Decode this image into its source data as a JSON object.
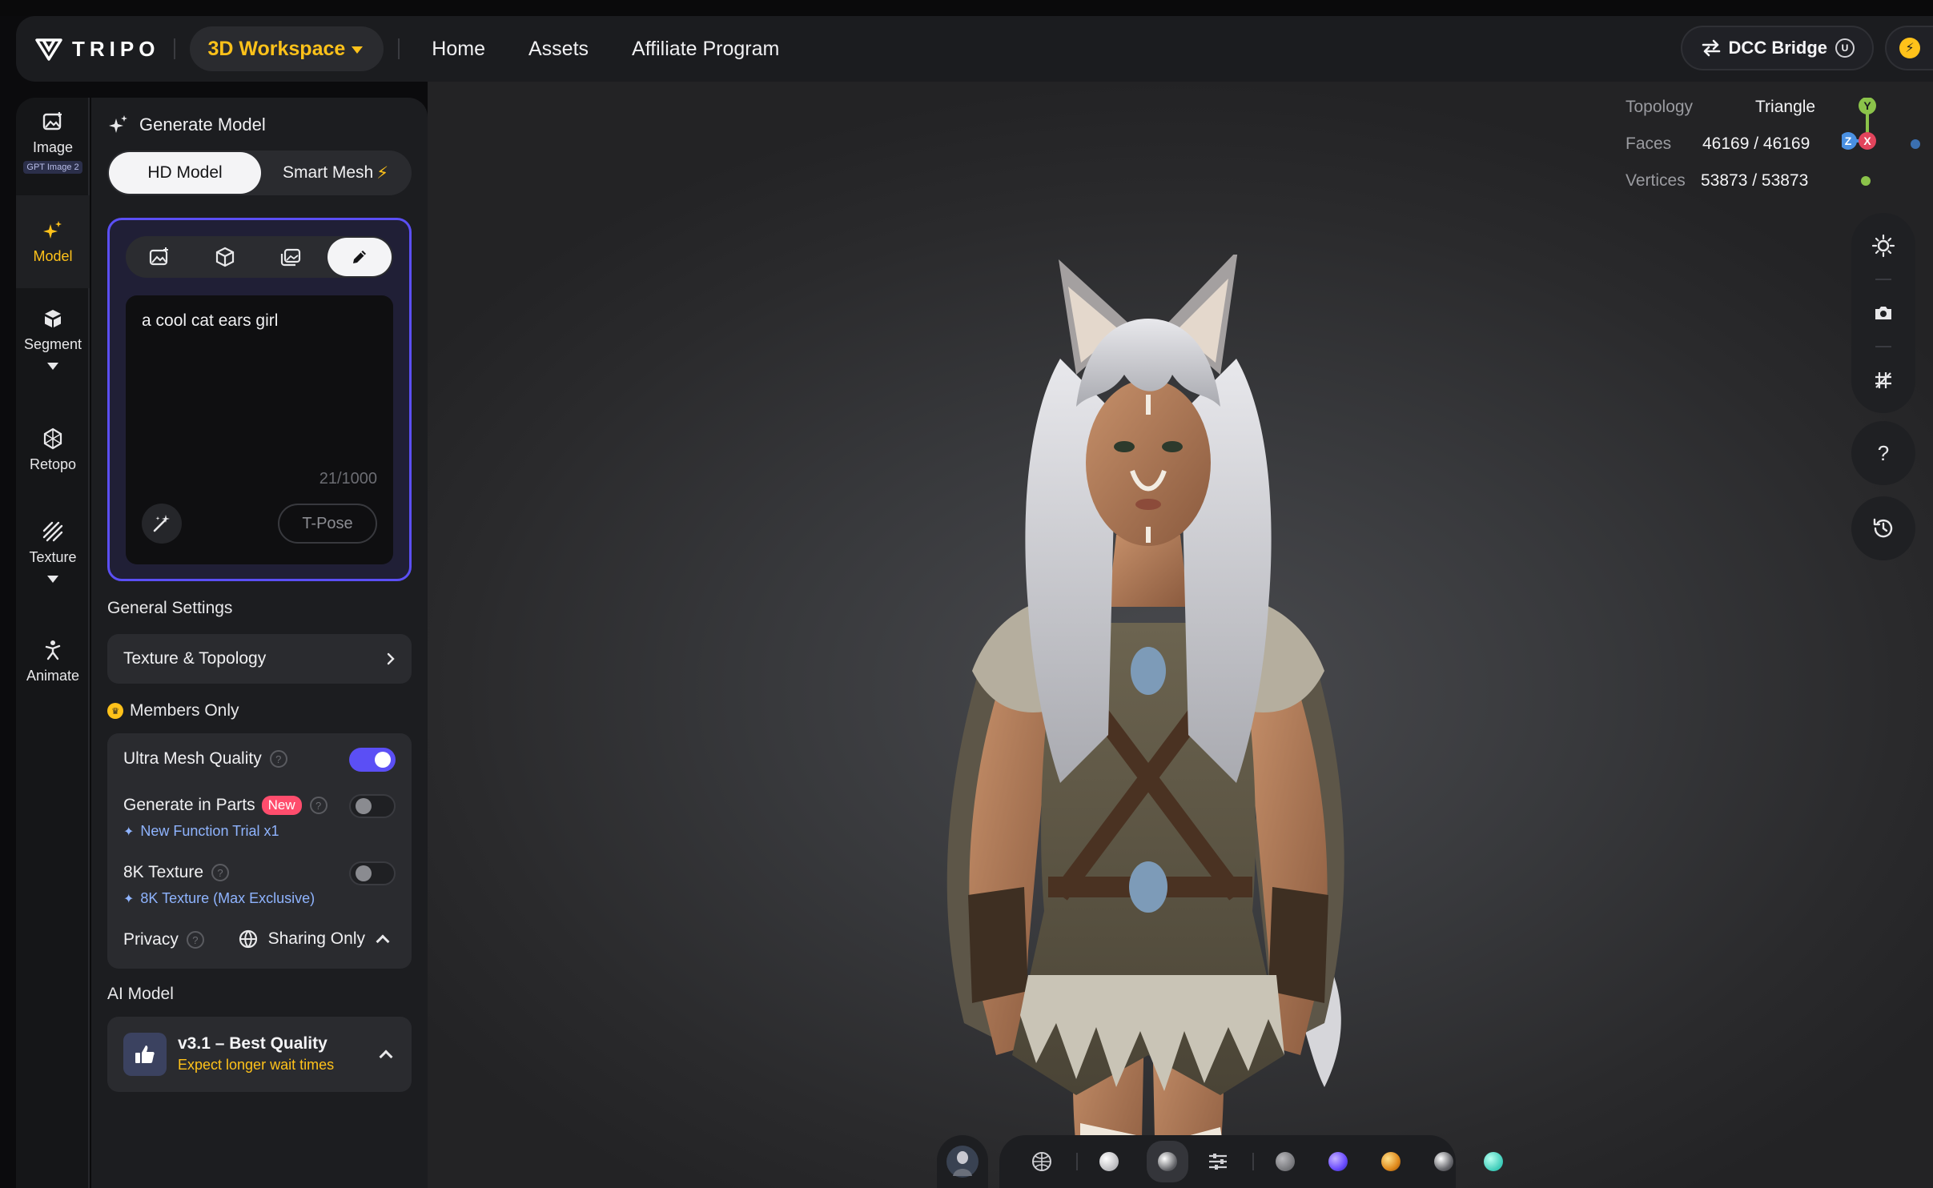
{
  "header": {
    "logo_text": "TRIPO",
    "workspace_label": "3D Workspace",
    "nav": [
      "Home",
      "Assets",
      "Affiliate Program"
    ],
    "dcc_label": "DCC Bridge",
    "dcc_badge": "U"
  },
  "rail": {
    "items": [
      {
        "label": "Image",
        "badge": "GPT Image 2",
        "icon": "image-icon"
      },
      {
        "label": "Model",
        "icon": "sparkle-icon",
        "active": true
      },
      {
        "label": "Segment",
        "icon": "cube-split-icon",
        "expandable": true
      },
      {
        "label": "Retopo",
        "icon": "mesh-icon"
      },
      {
        "label": "Texture",
        "icon": "texture-icon",
        "expandable": true
      },
      {
        "label": "Animate",
        "icon": "figure-icon"
      }
    ]
  },
  "panel": {
    "title": "Generate Model",
    "model_tabs": {
      "hd": "HD Model",
      "smart": "Smart Mesh"
    },
    "input_tabs": [
      "image-input-icon",
      "3d-input-icon",
      "multiview-input-icon",
      "text-input-icon"
    ],
    "prompt": {
      "text": "a cool cat ears girl",
      "count": "21/1000",
      "tpose": "T-Pose"
    },
    "general_settings": "General Settings",
    "texture_topology": "Texture & Topology",
    "members_only": "Members Only",
    "options": {
      "ultra_mesh": {
        "label": "Ultra Mesh Quality",
        "enabled": true
      },
      "parts": {
        "label": "Generate in Parts",
        "badge": "New",
        "note": "New Function Trial x1",
        "enabled": false
      },
      "texture8k": {
        "label": "8K Texture",
        "note": "8K Texture (Max Exclusive)",
        "enabled": false
      },
      "privacy": {
        "label": "Privacy",
        "value": "Sharing Only"
      }
    },
    "ai_model": {
      "section": "AI Model",
      "name": "v3.1 – Best Quality",
      "note": "Expect longer wait times"
    }
  },
  "viewport": {
    "stats": {
      "topology_label": "Topology",
      "topology_value": "Triangle",
      "faces_label": "Faces",
      "faces_value": "46169 / 46169",
      "vertices_label": "Vertices",
      "vertices_value": "53873 / 53873"
    },
    "gizmo": {
      "y": "Y",
      "z": "Z",
      "x": "X"
    },
    "help_label": "?"
  },
  "colors": {
    "accent": "#ffc21a",
    "primary": "#5b4ff5",
    "link": "#8fb4ff",
    "new_badge": "#ff4d6d"
  }
}
